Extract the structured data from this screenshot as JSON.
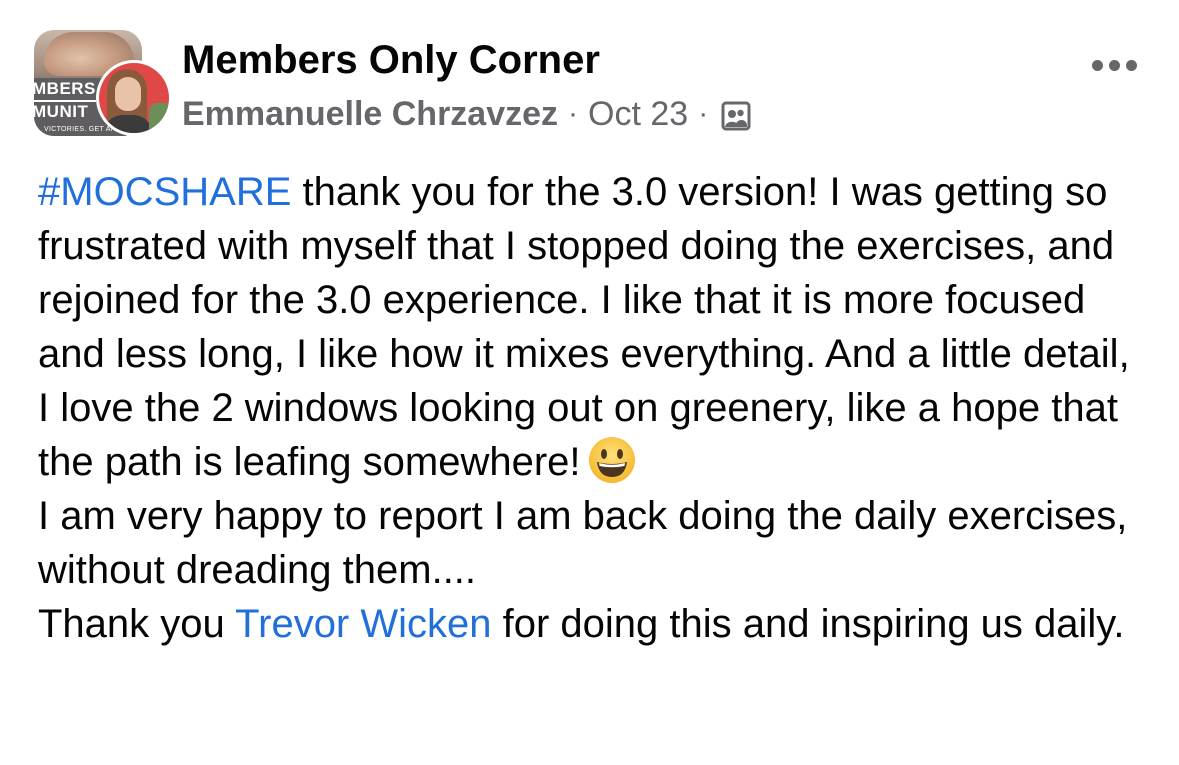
{
  "header": {
    "group_name": "Members Only Corner",
    "author": "Emmanuelle Chrzavzez",
    "separator": "·",
    "date": "Oct 23",
    "group_avatar_lines": [
      "MBERS",
      "MUNIT",
      "VICTORIES. GET AN"
    ],
    "privacy_icon": "group-members-icon",
    "more_icon": "more-options-icon"
  },
  "post": {
    "hashtag": "#MOCSHARE",
    "paragraph1_after_hashtag": " thank you for the 3.0 version! I was getting so frustrated with myself that I stopped doing the exercises, and rejoined for the 3.0 experience. I like that it is more focused and less long, I like how it mixes everything. And a little detail, I love the 2 windows looking out on greenery, like a hope that the path is leafing somewhere!",
    "emoji": "grinning-face-emoji",
    "paragraph2": "I am very happy to report I am back doing the daily exercises, without dreading them....",
    "paragraph3_before_mention": "Thank you ",
    "mention": "Trevor Wicken",
    "paragraph3_after_mention": " for doing this and inspiring us daily."
  },
  "colors": {
    "link": "#216fdb",
    "secondary_text": "#65676b",
    "primary_text": "#050505",
    "background": "#ffffff"
  }
}
